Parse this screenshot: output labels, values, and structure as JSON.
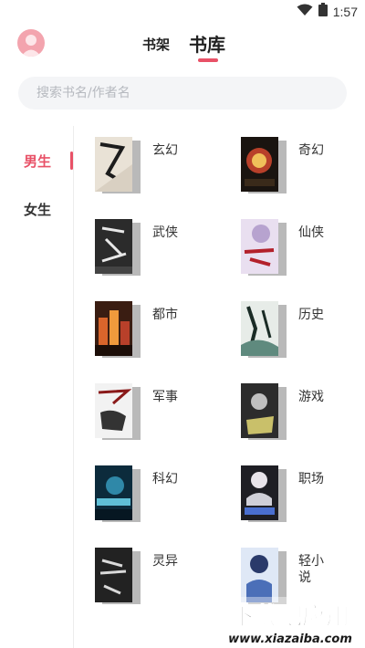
{
  "status_bar": {
    "time": "1:57",
    "icons": [
      "wifi-icon",
      "battery-icon"
    ]
  },
  "header": {
    "avatar_icon": "user-avatar-icon",
    "tabs": [
      {
        "label": "书架",
        "active": false
      },
      {
        "label": "书库",
        "active": true
      }
    ]
  },
  "search": {
    "placeholder": "搜索书名/作者名",
    "value": ""
  },
  "gender_nav": {
    "items": [
      {
        "label": "男生",
        "active": true
      },
      {
        "label": "女生",
        "active": false
      }
    ]
  },
  "categories": [
    {
      "label": "玄幻"
    },
    {
      "label": "奇幻"
    },
    {
      "label": "武侠"
    },
    {
      "label": "仙侠"
    },
    {
      "label": "都市"
    },
    {
      "label": "历史"
    },
    {
      "label": "军事"
    },
    {
      "label": "游戏"
    },
    {
      "label": "科幻"
    },
    {
      "label": "职场"
    },
    {
      "label": "灵异"
    },
    {
      "label": "轻小说"
    }
  ],
  "colors": {
    "accent": "#e85167",
    "search_bg": "#f4f5f7"
  },
  "watermark": {
    "text": "下载吧应用",
    "url_text": "www.xiazaiba.com"
  }
}
